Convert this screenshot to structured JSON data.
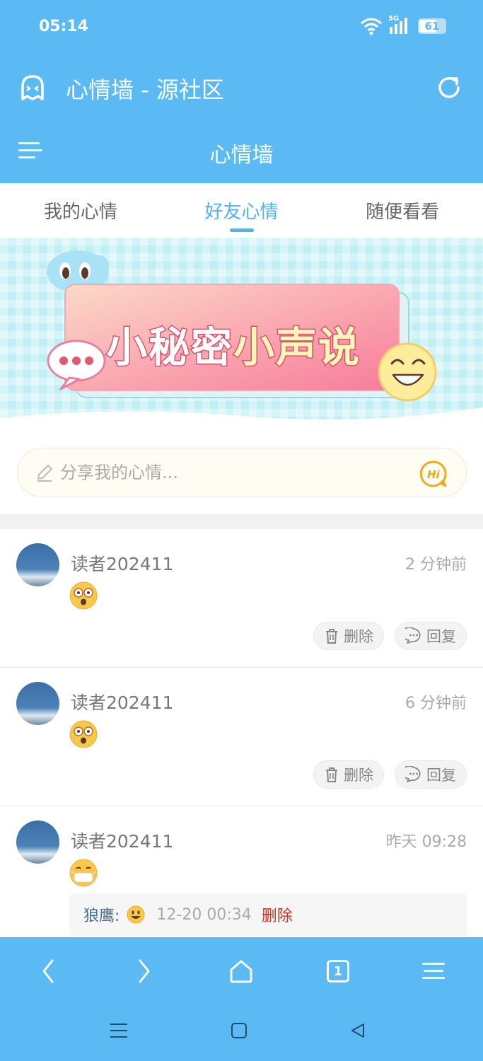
{
  "status_bar": {
    "time": "05:14",
    "network": "5G",
    "battery": "61"
  },
  "title_bar": {
    "title": "心情墙 - 源社区"
  },
  "nav_bar": {
    "title": "心情墙"
  },
  "tabs": [
    {
      "label": "我的心情",
      "active": false
    },
    {
      "label": "好友心情",
      "active": true
    },
    {
      "label": "随便看看",
      "active": false
    }
  ],
  "banner": {
    "text_left": "小秘密",
    "text_right": "小声说"
  },
  "mood_input": {
    "placeholder": "分享我的心情..."
  },
  "posts": [
    {
      "username": "读者202411",
      "time": "2 分钟前",
      "mood_icon": "surprised-face-icon",
      "delete_label": "删除",
      "reply_label": "回复"
    },
    {
      "username": "读者202411",
      "time": "6 分钟前",
      "mood_icon": "surprised-face-icon",
      "delete_label": "删除",
      "reply_label": "回复"
    },
    {
      "username": "读者202411",
      "time": "昨天 09:28",
      "mood_icon": "masked-face-icon",
      "reply": {
        "name": "狼鹰:",
        "emoji": "grinning-face-icon",
        "time": "12-20 00:34",
        "delete_label": "删除"
      }
    }
  ],
  "bottom_nav": {
    "tab_count": "1"
  },
  "colors": {
    "primary": "#5bb9f3",
    "active_tab": "#4fb3ee",
    "reply_name": "#3f6f9c",
    "delete": "#c0392b"
  }
}
